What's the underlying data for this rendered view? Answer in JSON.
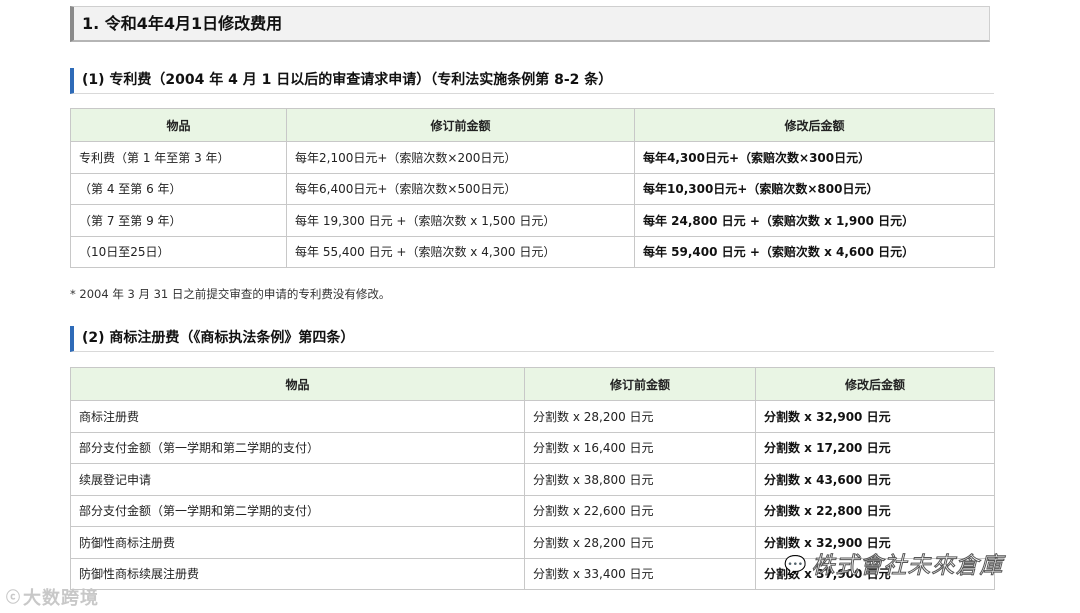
{
  "main_title": "1. 令和4年4月1日修改费用",
  "section1": {
    "title": "(1) 专利费（2004 年 4 月 1 日以后的审查请求申请）（专利法实施条例第 8-2 条）",
    "headers": [
      "物品",
      "修订前金额",
      "修改后金额"
    ],
    "rows": [
      {
        "item": "专利费（第 1 年至第 3 年）",
        "before": "每年2,100日元+（索赔次数×200日元）",
        "after": "每年4,300日元+（索赔次数×300日元）"
      },
      {
        "item": "（第 4 至第 6 年）",
        "before": "每年6,400日元+（索赔次数×500日元）",
        "after": "每年10,300日元+（索赔次数×800日元）"
      },
      {
        "item": "（第 7 至第 9 年）",
        "before": "每年 19,300 日元 +（索赔次数 x 1,500 日元）",
        "after": "每年 24,800 日元 +（索赔次数 x 1,900 日元）"
      },
      {
        "item": "（10日至25日）",
        "before": "每年 55,400 日元 +（索赔次数 x 4,300 日元）",
        "after": "每年 59,400 日元 +（索赔次数 x 4,600 日元）"
      }
    ],
    "note": "* 2004 年 3 月 31 日之前提交审查的申请的专利费没有修改。"
  },
  "section2": {
    "title": "(2) 商标注册费（《商标执法条例》第四条）",
    "headers": [
      "物品",
      "修订前金额",
      "修改后金额"
    ],
    "rows": [
      {
        "item": "商标注册费",
        "before": "分割数 x 28,200 日元",
        "after": "分割数 x 32,900 日元"
      },
      {
        "item": "部分支付金额（第一学期和第二学期的支付）",
        "before": "分割数 x 16,400 日元",
        "after": "分割数 x 17,200 日元"
      },
      {
        "item": "续展登记申请",
        "before": "分割数 x 38,800 日元",
        "after": "分割数 x 43,600 日元"
      },
      {
        "item": "部分支付金额（第一学期和第二学期的支付）",
        "before": "分割数 x 22,600 日元",
        "after": "分割数 x 22,800 日元"
      },
      {
        "item": "防御性商标注册费",
        "before": "分割数 x 28,200 日元",
        "after": "分割数 x 32,900 日元"
      },
      {
        "item": "防御性商标续展注册费",
        "before": "分割数 x 33,400 日元",
        "after": "分割数 x 37,900 日元"
      }
    ]
  },
  "watermarks": {
    "left": "大数跨境",
    "right": "株式會社未來倉庫"
  },
  "colors": {
    "header_bg": "#e9f5e4",
    "section_bar": "#2e6bb8",
    "title_bg": "#f2f2f2"
  }
}
